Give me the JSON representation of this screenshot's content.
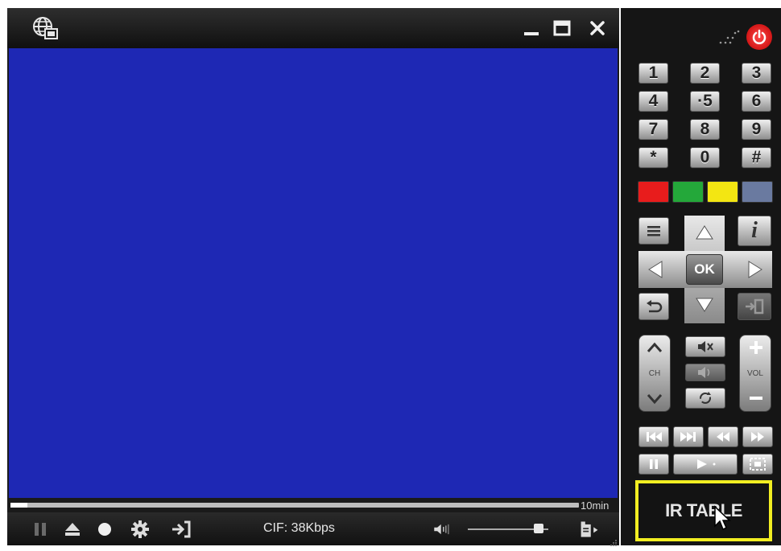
{
  "player": {
    "progress": 0.03,
    "duration_label": "10min",
    "bitrate_label": "CIF: 38Kbps",
    "volume": 0.88,
    "video_color": "#1e28b4"
  },
  "remote": {
    "numpad": [
      "1",
      "2",
      "3",
      "4",
      "·5",
      "6",
      "7",
      "8",
      "9",
      "*",
      "0",
      "#"
    ],
    "color_keys": [
      "#e81c1c",
      "#24a83a",
      "#f3e612",
      "#6a7aa0"
    ],
    "ok_label": "OK",
    "info_label": "i",
    "ch_label": "CH",
    "vol_label": "VOL",
    "ir_table_label": "IR TABLE",
    "power_color": "#e02020",
    "highlight_color": "#f2ee22"
  }
}
